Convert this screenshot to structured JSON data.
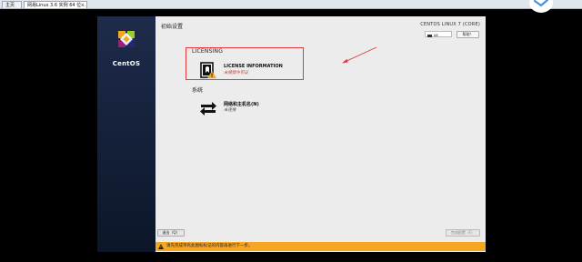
{
  "browser": {
    "tabs": [
      {
        "label": "主页"
      },
      {
        "label": "网易Linux 3.6 实例 64 位..."
      }
    ]
  },
  "sidebar": {
    "brand": "CentOS"
  },
  "header": {
    "title": "初始设置",
    "product": "CENTOS LINUX 7 (CORE)",
    "keyboard": "us",
    "help_label": "帮助！"
  },
  "licensing": {
    "section_label": "LICENSING",
    "title": "LICENSE INFORMATION",
    "status": "未接受许可证"
  },
  "system": {
    "section_label": "系统",
    "title": "网络和主机名(N)",
    "status": "未连接"
  },
  "footer": {
    "quit_label": "退出（Q）",
    "finish_label": "完成配置（F）",
    "warning": "请先完成带有此图标标记的内容再进行下一步。"
  },
  "colors": {
    "highlight": "#e53935",
    "warning_bar": "#f5a623",
    "panel": "#1e2b4a"
  }
}
